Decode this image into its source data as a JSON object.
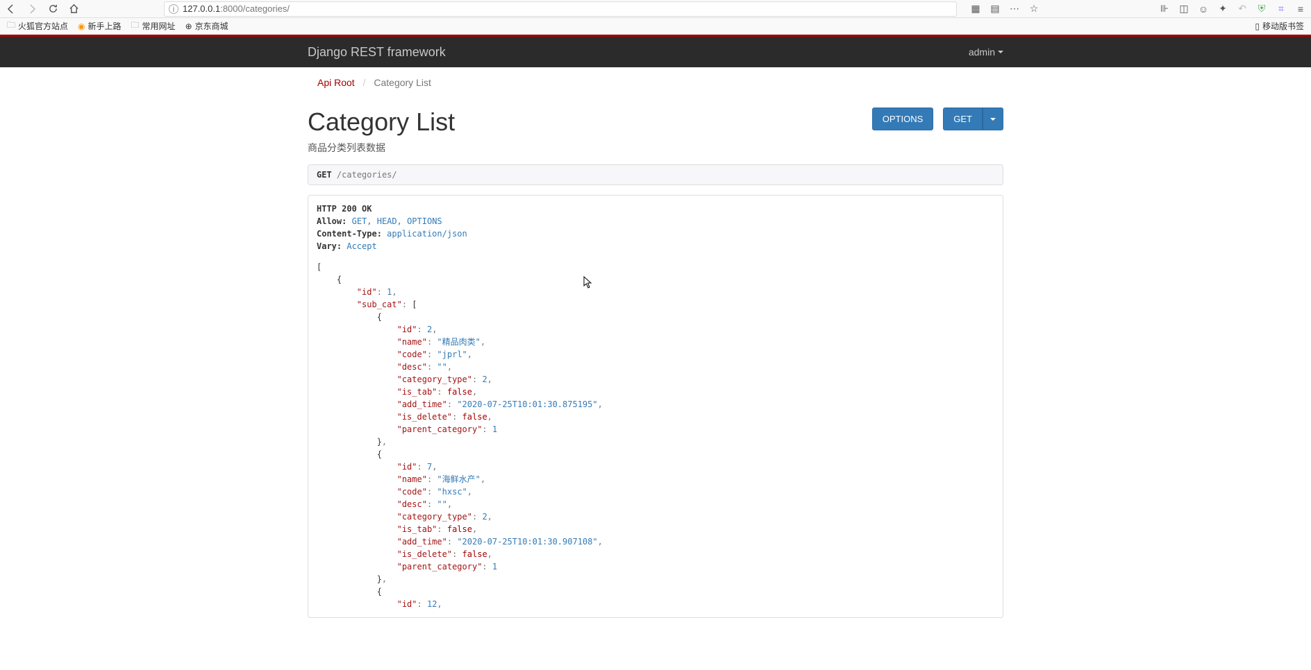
{
  "browser": {
    "url_pre": "127.0.0.1",
    "url_post": ":8000/categories/",
    "bookmarks": [
      {
        "icon": "folder",
        "label": "火狐官方站点"
      },
      {
        "icon": "firefox",
        "label": "新手上路"
      },
      {
        "icon": "folder",
        "label": "常用网址"
      },
      {
        "icon": "globe",
        "label": "京东商城"
      }
    ],
    "mobile_bookmark": "移动版书签"
  },
  "navbar": {
    "brand": "Django REST framework",
    "user": "admin"
  },
  "breadcrumb": {
    "root": "Api Root",
    "current": "Category List"
  },
  "page": {
    "title": "Category List",
    "description": "商品分类列表数据",
    "options_btn": "OPTIONS",
    "get_btn": "GET"
  },
  "request": {
    "method": "GET",
    "path": "/categories/"
  },
  "response": {
    "status_line": "HTTP 200 OK",
    "headers": [
      {
        "name": "Allow",
        "value": "GET, HEAD, OPTIONS"
      },
      {
        "name": "Content-Type",
        "value": "application/json"
      },
      {
        "name": "Vary",
        "value": "Accept"
      }
    ],
    "body": [
      {
        "id": 1,
        "sub_cat": [
          {
            "id": 2,
            "name": "精品肉类",
            "code": "jprl",
            "desc": "",
            "category_type": 2,
            "is_tab": false,
            "add_time": "2020-07-25T10:01:30.875195",
            "is_delete": false,
            "parent_category": 1
          },
          {
            "id": 7,
            "name": "海鲜水产",
            "code": "hxsc",
            "desc": "",
            "category_type": 2,
            "is_tab": false,
            "add_time": "2020-07-25T10:01:30.907108",
            "is_delete": false,
            "parent_category": 1
          },
          {
            "id": 12
          }
        ]
      }
    ]
  }
}
